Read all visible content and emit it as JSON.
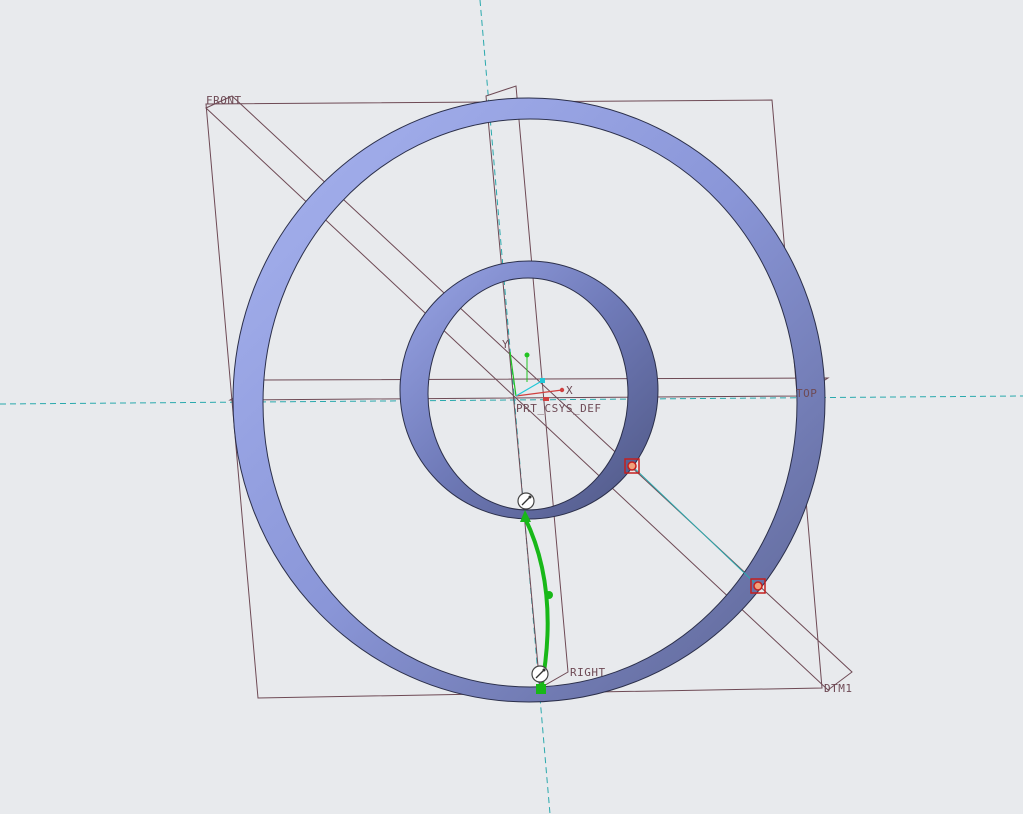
{
  "planes": {
    "front": "FRONT",
    "top": "TOP",
    "right": "RIGHT",
    "dtm1": "DTM1"
  },
  "csys": {
    "name": "PRT_CSYS_DEF",
    "x_label": "X",
    "y_label": "Y"
  },
  "colors": {
    "background": "#e8eaed",
    "surface_light": "#a4b0ee",
    "surface_dark": "#5a6290",
    "datum_plane": "#6e4a55",
    "datum_axis": "#2aa9ad",
    "selection": "#18b818",
    "point_marker": "#c41f1f"
  },
  "icons": {
    "drag_handle": "drag-handle-icon",
    "datum_point": "datum-point-icon"
  }
}
